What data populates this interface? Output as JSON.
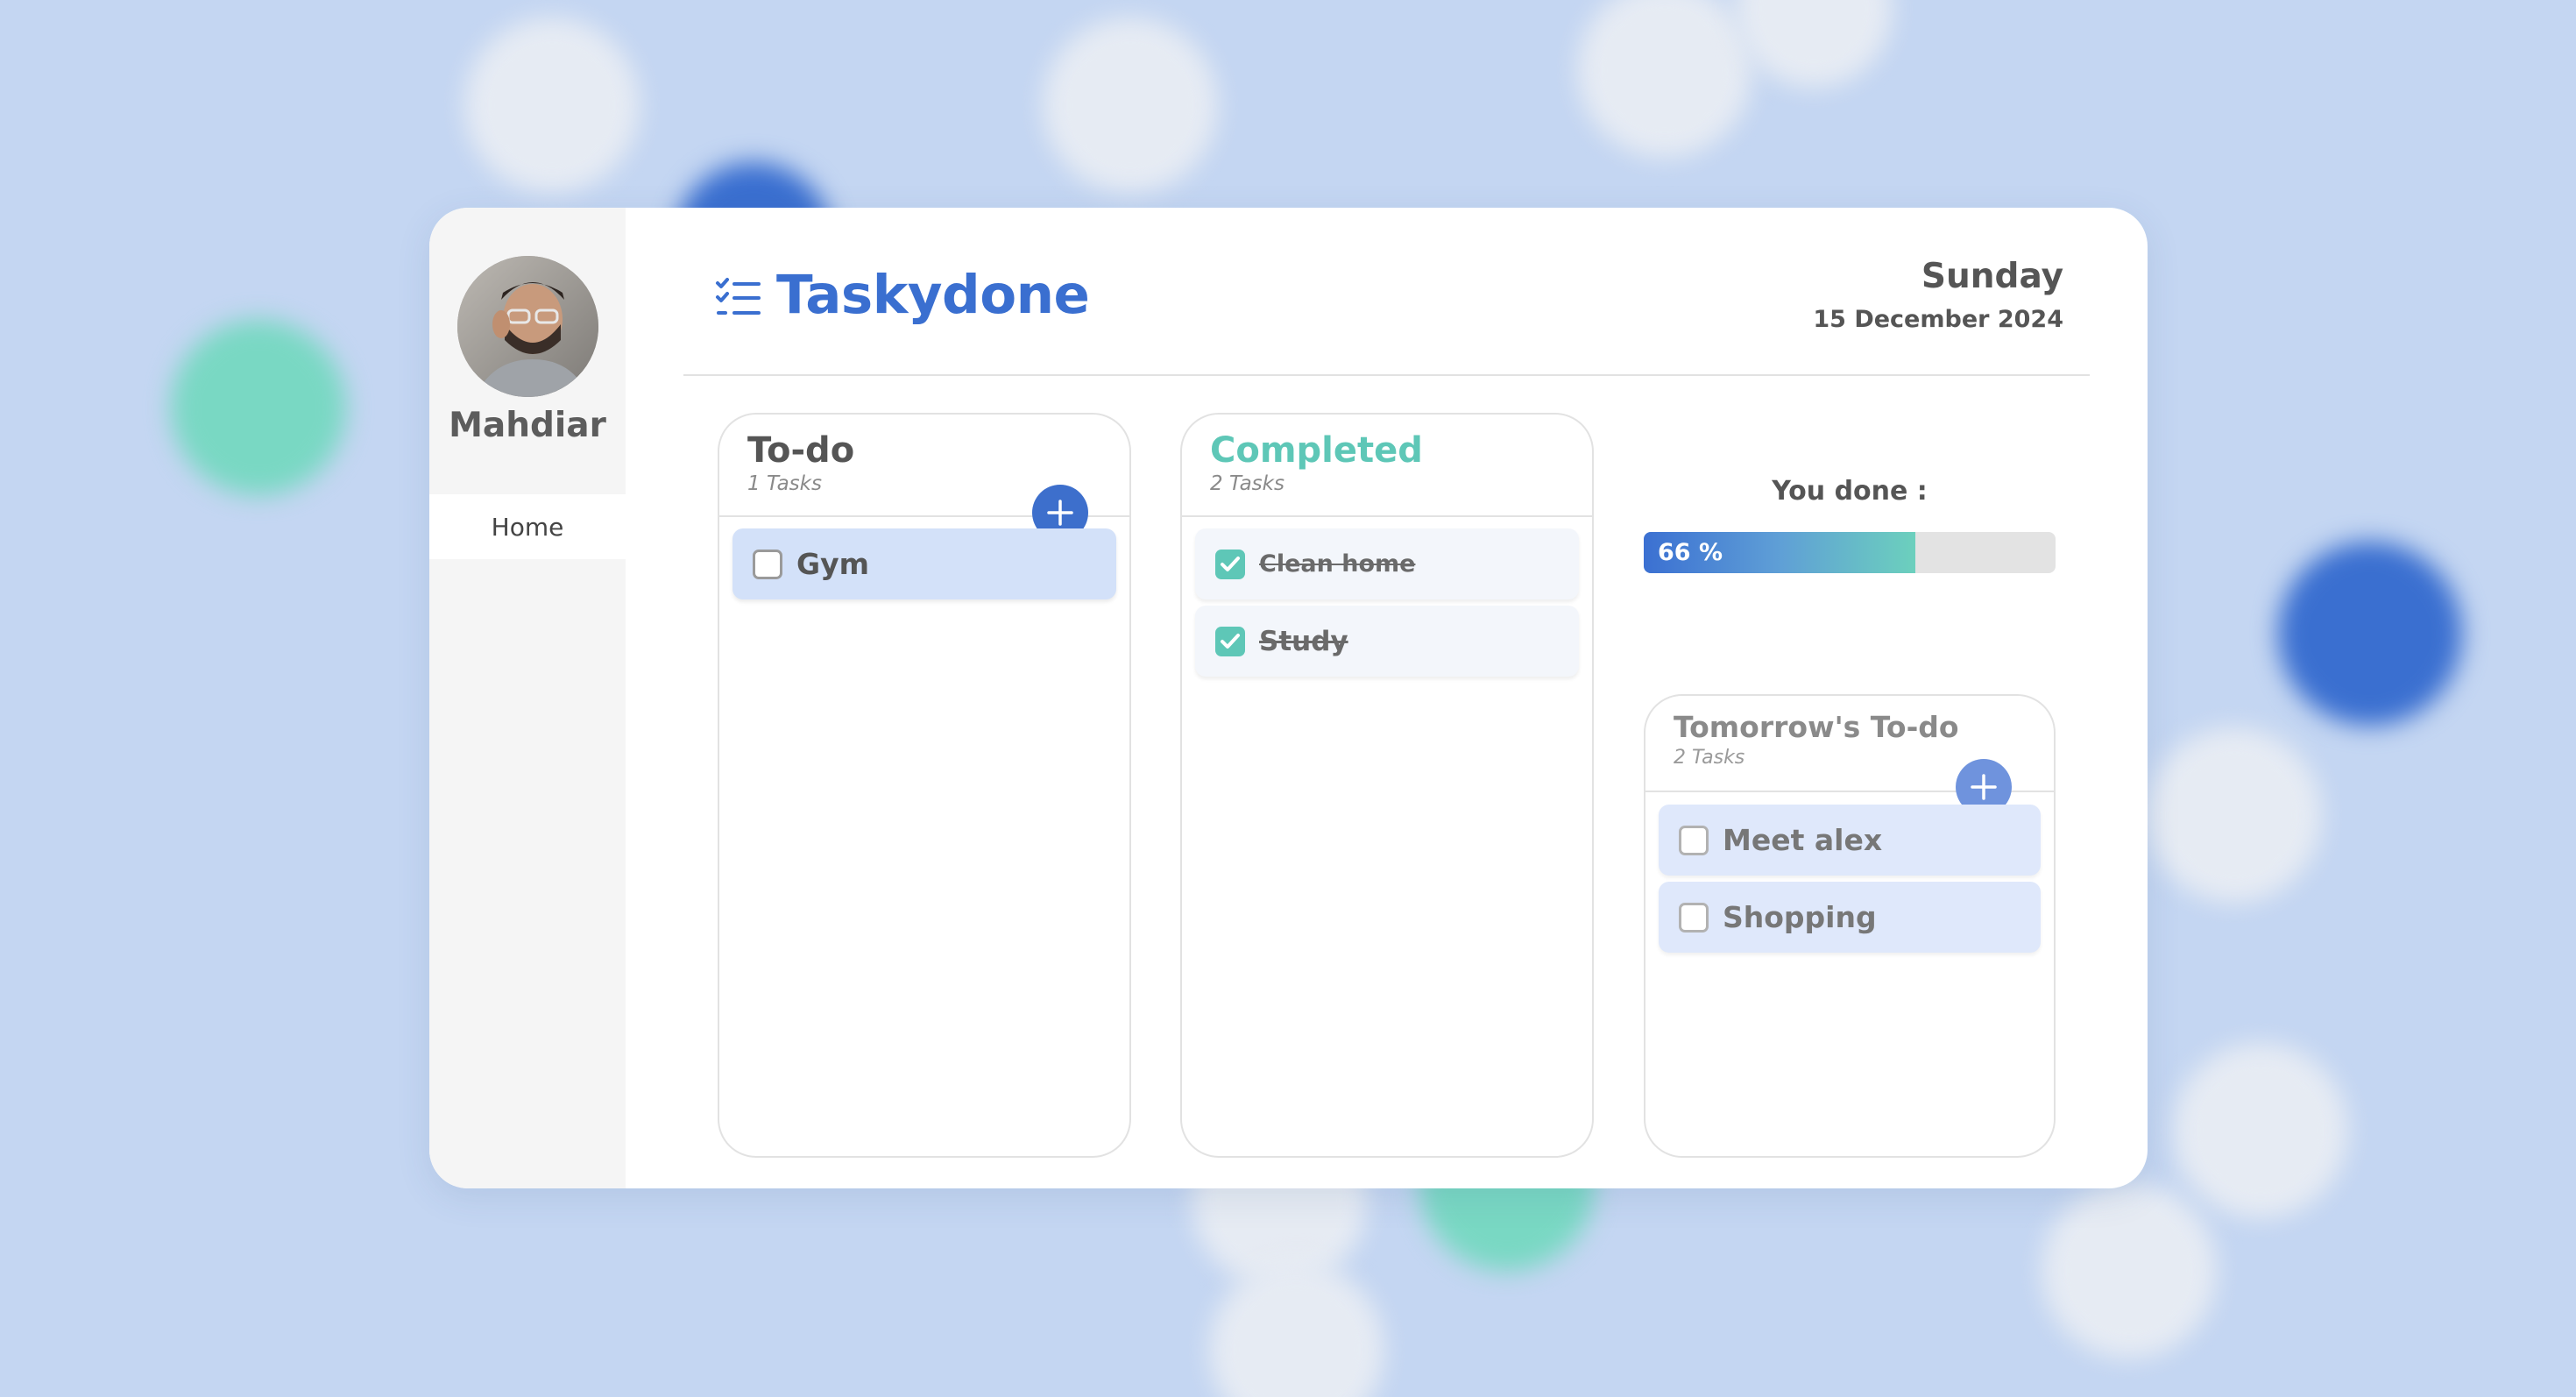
{
  "app": {
    "title": "Taskydone"
  },
  "user": {
    "name": "Mahdiar"
  },
  "nav": {
    "home_label": "Home"
  },
  "date": {
    "day": "Sunday",
    "full": "15 December 2024"
  },
  "todo": {
    "title": "To-do",
    "count": "1 Tasks",
    "items": [
      {
        "label": "Gym",
        "checked": false
      }
    ]
  },
  "completed": {
    "title": "Completed",
    "count": "2 Tasks",
    "items": [
      {
        "label": "Clean home",
        "checked": true
      },
      {
        "label": "Study",
        "checked": true
      }
    ]
  },
  "progress": {
    "label": "You done :",
    "value_text": "66 %",
    "percent": 66
  },
  "tomorrow": {
    "title": "Tomorrow's To-do",
    "count": "2 Tasks",
    "items": [
      {
        "label": "Meet alex",
        "checked": false
      },
      {
        "label": "Shopping",
        "checked": false
      }
    ]
  },
  "colors": {
    "brand": "#3a6fd0",
    "completed_accent": "#5ec7b7",
    "background": "#c4d6f2",
    "card": "#ffffff",
    "sidebar": "#f5f5f5"
  },
  "icons": {
    "logo": "checklist-icon",
    "add": "plus-icon",
    "check": "checkmark-icon"
  }
}
